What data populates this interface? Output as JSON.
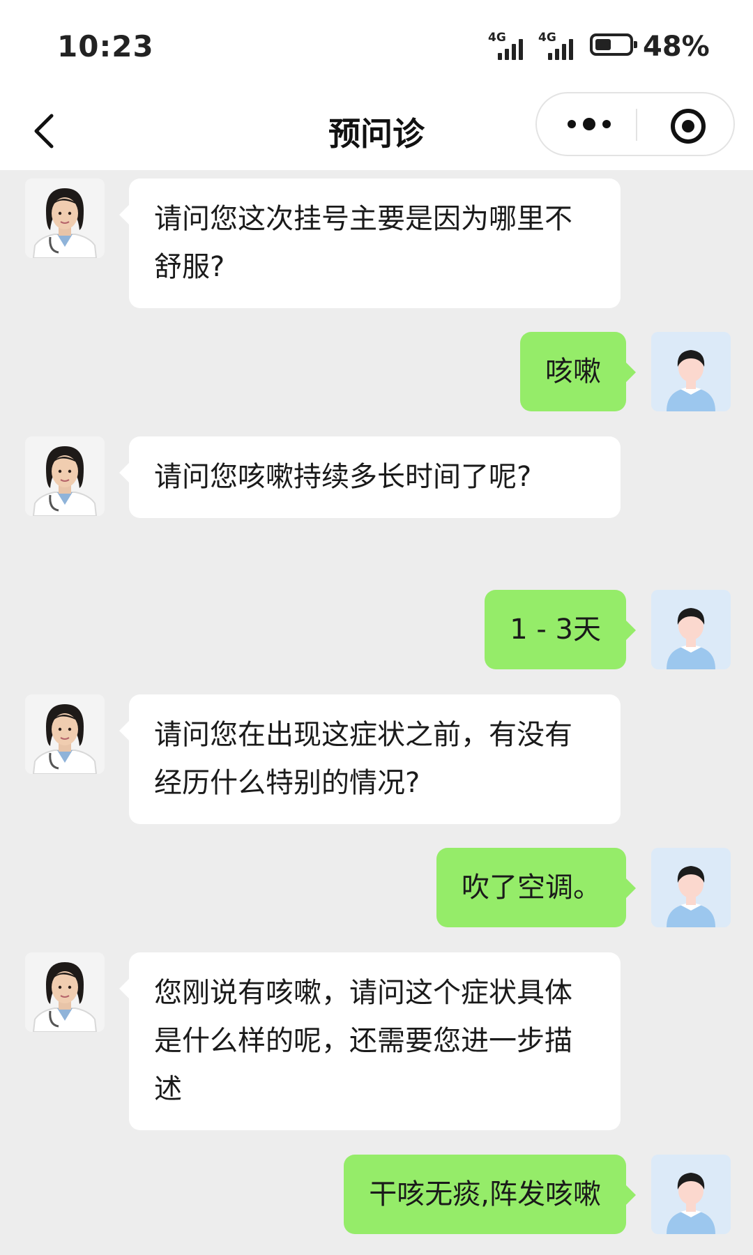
{
  "status_bar": {
    "time": "10:23",
    "network_labels": [
      "4G",
      "4G"
    ],
    "battery_percent": "48%",
    "battery_level": 0.48
  },
  "nav": {
    "title": "预问诊",
    "back_icon": "chevron-left-icon",
    "more_icon": "more-dots-icon",
    "close_icon": "target-circle-icon"
  },
  "messages": [
    {
      "sender": "doctor",
      "text": "请问您这次挂号主要是因为哪里不舒服?"
    },
    {
      "sender": "patient",
      "text": "咳嗽"
    },
    {
      "sender": "doctor",
      "text": "请问您咳嗽持续多长时间了呢?"
    },
    {
      "sender": "patient",
      "text": "1 - 3天"
    },
    {
      "sender": "doctor",
      "text": "请问您在出现这症状之前，有没有经历什么特别的情况?"
    },
    {
      "sender": "patient",
      "text": "吹了空调。"
    },
    {
      "sender": "doctor",
      "text": "您刚说有咳嗽，请问这个症状具体是什么样的呢，还需要您进一步描述"
    },
    {
      "sender": "patient",
      "text": "干咳无痰,阵发咳嗽"
    }
  ],
  "colors": {
    "background": "#ededed",
    "patient_bubble": "#95ec69",
    "doctor_bubble": "#ffffff",
    "patient_avatar_bg": "#dceaf8"
  }
}
